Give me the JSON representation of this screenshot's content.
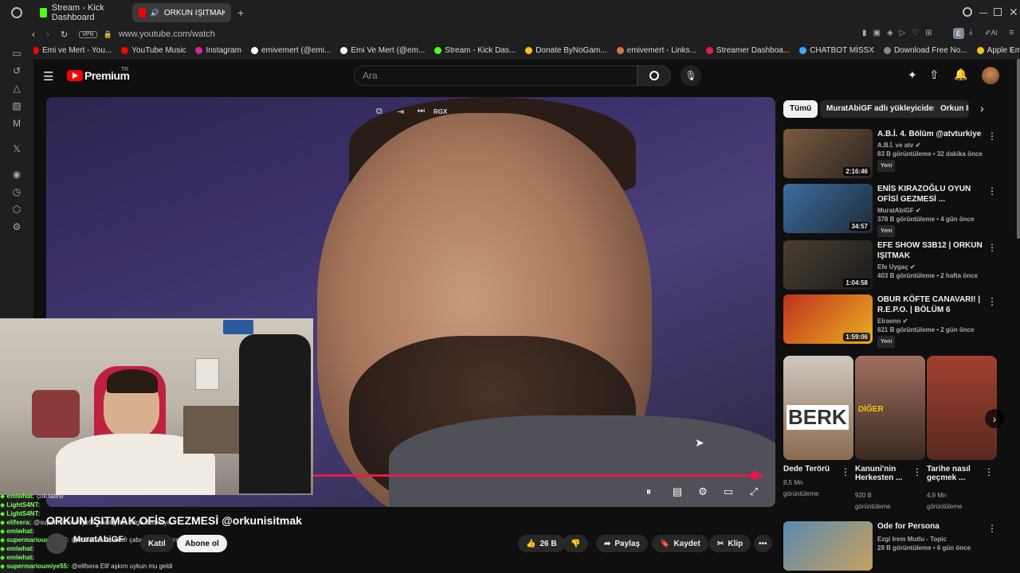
{
  "browser": {
    "tabs": [
      {
        "label": "Stream - Kick Dashboard",
        "color": "#53fc18"
      },
      {
        "label": "ORKUN IŞITMAK OFİS",
        "color": "#ff0000"
      }
    ],
    "new_tab": "+",
    "url": "www.youtube.com/watch",
    "vpn": "VPN",
    "bookmarks": [
      {
        "label": "Emi ve Mert - You...",
        "color": "#ff0000"
      },
      {
        "label": "YouTube Music",
        "color": "#ff0000"
      },
      {
        "label": "Instagram",
        "color": "#d6249f"
      },
      {
        "label": "emivemert (@emi...",
        "color": "#ffffff"
      },
      {
        "label": "Emi Ve Mert (@em...",
        "color": "#ffffff"
      },
      {
        "label": "Stream - Kick Das...",
        "color": "#53fc18"
      },
      {
        "label": "Donate ByNoGam...",
        "color": "#f5c518"
      },
      {
        "label": "emivemert - Links...",
        "color": "#c97b4a"
      },
      {
        "label": "Streamer Dashboa...",
        "color": "#e6194b"
      },
      {
        "label": "CHATBOT MİSSX",
        "color": "#4aa3ff"
      },
      {
        "label": "Download Free No...",
        "color": "#888888"
      },
      {
        "label": "Apple Emoji listesi...",
        "color": "#f5c518"
      }
    ]
  },
  "yt": {
    "logo": "Premium",
    "logo_sup": "TR",
    "search_placeholder": "Ara",
    "video_overlay": "RGX",
    "title": "ORKUN IŞITMAK OFİS GEZMESİ @orkunisitmak",
    "channel": "MuratAbiGF",
    "join": "Katıl",
    "subscribe": "Abone ol",
    "likes": "26 B",
    "share": "Paylaş",
    "save": "Kaydet",
    "clip": "Klip",
    "more": "•••",
    "progress_percent": 97
  },
  "chips": [
    "Tümü",
    "MuratAbiGF adlı yükleyiciden",
    "Orkun Iş"
  ],
  "recs": [
    {
      "title": "A.B.İ. 4. Bölüm @atvturkiye",
      "channel": "A.B.İ. ve atv",
      "meta": "83 B görüntüleme • 32 dakika önce",
      "badge": "Yeni",
      "dur": "2:16:46",
      "c1": "#7a5c40",
      "c2": "#2b2320"
    },
    {
      "title": "ENİS KIRAZOĞLU OYUN OFİSİ GEZMESİ ...",
      "channel": "MuratAbiGF",
      "meta": "378 B görüntüleme • 4 gün önce",
      "badge": "Yeni",
      "dur": "34:57",
      "c1": "#3a6ea0",
      "c2": "#1f2b3a"
    },
    {
      "title": "EFE SHOW S3B12 | ORKUN IŞITMAK",
      "channel": "Efe Uygaç",
      "meta": "403 B görüntüleme • 2 hafta önce",
      "badge": "",
      "dur": "1:04:58",
      "c1": "#4a4030",
      "c2": "#1a1a1a"
    },
    {
      "title": "OBUR KÖFTE CANAVARI! | R.E.P.O. | BÖLÜM 6",
      "channel": "Elraenn",
      "meta": "621 B görüntüleme • 2 gün önce",
      "badge": "Yeni",
      "dur": "1:59:06",
      "c1": "#c03020",
      "c2": "#e8b020"
    }
  ],
  "shorts": [
    {
      "title": "Dede Terörü",
      "views": "8,5 Mn",
      "unit": "görüntüleme",
      "c1": "#8a6a50",
      "c2": "#d0c8c0",
      "text": "BERK"
    },
    {
      "title": "Kanuni'nin Herkesten ...",
      "views": "920 B",
      "unit": "görüntüleme",
      "c1": "#3a2a20",
      "c2": "#a07060",
      "text": "DİĞER"
    },
    {
      "title": "Tarihe nasıl geçmek ...",
      "views": "4,9 Mn",
      "unit": "görüntüleme",
      "c1": "#5a2a20",
      "c2": "#a04030",
      "text": ""
    }
  ],
  "last_rec": {
    "title": "Ode for Persona",
    "channel": "Ezgi Irem Mutlu - Topic",
    "meta": "28 B görüntüleme • 6 gün önce"
  },
  "chat": [
    {
      "user": "emiwhat:",
      "msg": "çok tatlısı"
    },
    {
      "user": "LightS4NT:",
      "msg": ""
    },
    {
      "user": "LightS4NT:",
      "msg": ""
    },
    {
      "user": "elifsera:",
      "msg": "@supermarioumiye55 hadiiig her odge dottim ya"
    },
    {
      "user": "emiwhat:",
      "msg": ""
    },
    {
      "user": "supermarioumiye55:",
      "msg": "@emiwhat Karakter çaba istek ve hırs işi"
    },
    {
      "user": "emiwhat:",
      "msg": ""
    },
    {
      "user": "emiwhat:",
      "msg": ""
    },
    {
      "user": "supermarioumiye55:",
      "msg": "@elifsera Elif aşkım uykun mu geldi"
    }
  ]
}
